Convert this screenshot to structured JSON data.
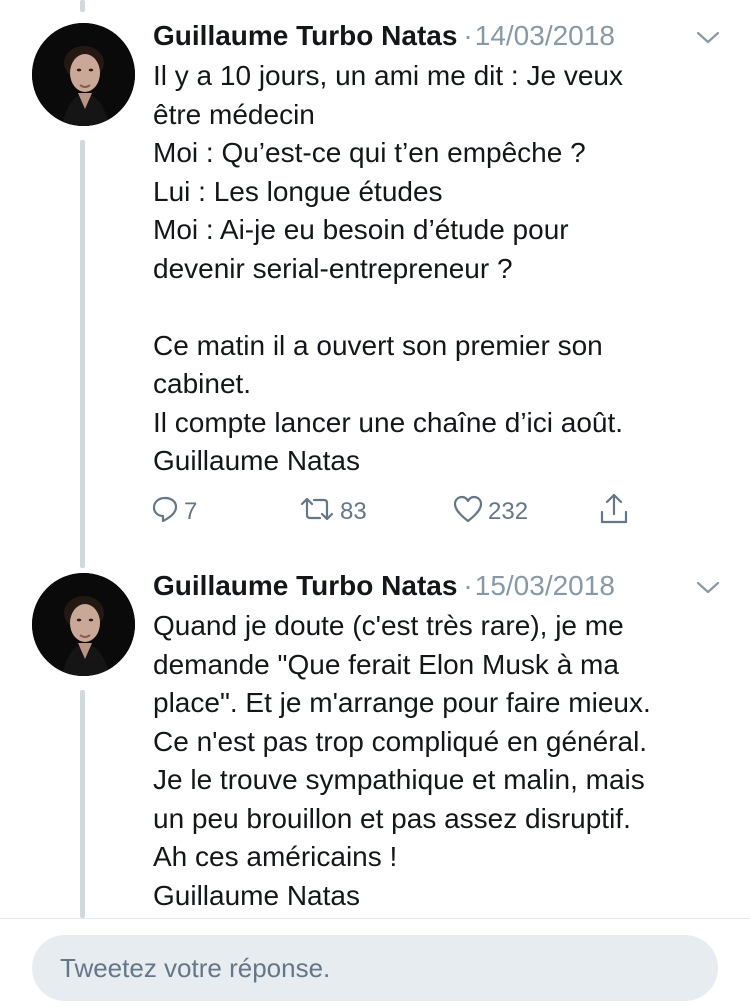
{
  "tweets": [
    {
      "author": "Guillaume Turbo Natas",
      "separator": "·",
      "date": "14/03/2018",
      "lines": [
        "Il y a 10 jours, un ami me dit : Je veux",
        "être médecin",
        "Moi : Qu’est-ce qui t’en empêche ?",
        "Lui : Les longue études",
        "Moi : Ai-je eu besoin d’étude pour",
        "devenir serial-entrepreneur ?",
        "",
        "Ce matin il a ouvert son premier son",
        "cabinet.",
        "Il compte lancer une chaîne d’ici août.",
        "Guillaume Natas"
      ],
      "actions": {
        "replies": "7",
        "retweets": "83",
        "likes": "232"
      }
    },
    {
      "author": "Guillaume Turbo Natas",
      "separator": "·",
      "date": "15/03/2018",
      "lines": [
        "Quand je doute (c'est très rare), je me",
        "demande \"Que ferait Elon Musk à ma",
        "place\". Et je m'arrange pour faire mieux.",
        "Ce n'est pas trop compliqué en général.",
        "Je le trouve sympathique et malin, mais",
        "un peu brouillon et pas assez disruptif.",
        "Ah ces américains !",
        "Guillaume Natas"
      ]
    }
  ],
  "reply": {
    "placeholder": "Tweetez votre réponse."
  },
  "icons": {
    "reply": "reply-icon",
    "retweet": "retweet-icon",
    "like": "heart-icon",
    "share": "share-icon",
    "more": "chevron-down-icon"
  },
  "colors": {
    "text": "#14171a",
    "secondary": "#657786",
    "thread_line": "#cfd9de",
    "reply_box": "#e6ecf0"
  }
}
